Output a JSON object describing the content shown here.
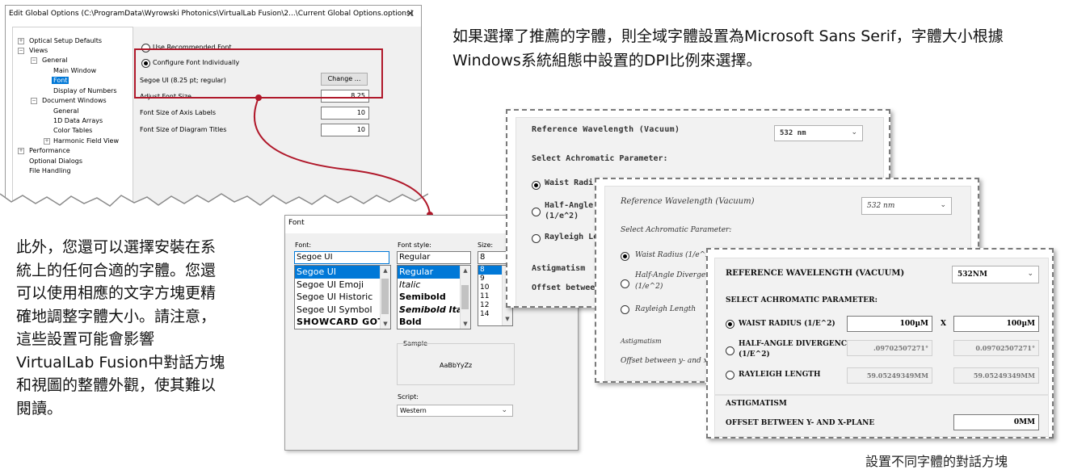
{
  "top_text": "如果選擇了推薦的字體，則全域字體設置為Microsoft Sans Serif，字體大小根據Windows系統組態中設置的DPI比例來選擇。",
  "top_text_lines": [
    "如果選擇了推薦的字體，則全域字體設置為Microsoft Sans Serif，字體大小根據",
    "Windows系統組態中設置的DPI比例來選擇。"
  ],
  "left_text_lines": [
    "此外，您還可以選擇安裝在系",
    "統上的任何合適的字體。您還",
    "可以使用相應的文字方塊更精",
    "確地調整字體大小。請注意，",
    "這些設置可能會影響",
    "VirtualLab Fusion中對話方塊",
    "和視圖的整體外觀，使其難以",
    "閱讀。"
  ],
  "caption": "設置不同字體的對話方塊",
  "global_options": {
    "title": "Edit Global Options (C:\\ProgramData\\Wyrowski Photonics\\VirtualLab Fusion\\2...\\Current Global Options.options)",
    "close": "✕",
    "tree": {
      "optical_setup_defaults": "Optical Setup Defaults",
      "views": "Views",
      "general": "General",
      "main_window": "Main Window",
      "font": "Font",
      "display_of_numbers": "Display of Numbers",
      "document_windows": "Document Windows",
      "dw_general": "General",
      "data_arrays": "1D Data Arrays",
      "color_tables": "Color Tables",
      "harmonic_field_view": "Harmonic Field View",
      "performance": "Performance",
      "optional_dialogs": "Optional Dialogs",
      "file_handling": "File Handling"
    },
    "use_recommended_font": "Use Recommended Font",
    "configure_font_individually": "Configure Font Individually",
    "current_font": "Segoe UI (8.25 pt; regular)",
    "change_button": "Change ...",
    "adjust_font_size_label": "Adjust Font Size",
    "adjust_font_size_value": "8.25",
    "axis_labels_label": "Font Size of Axis Labels",
    "axis_labels_value": "10",
    "diagram_titles_label": "Font Size of Diagram Titles",
    "diagram_titles_value": "10"
  },
  "font_dialog": {
    "title": "Font",
    "font_label": "Font:",
    "font_value": "Segoe UI",
    "fonts": [
      "Segoe UI",
      "Segoe UI Emoji",
      "Segoe UI Historic",
      "Segoe UI Symbol",
      "SHOWCARD GOTHI"
    ],
    "style_label": "Font style:",
    "style_value": "Regular",
    "styles": [
      "Regular",
      "Italic",
      "Semibold",
      "Semibold Italic",
      "Bold"
    ],
    "size_label": "Size:",
    "size_value": "8",
    "sizes": [
      "8",
      "9",
      "10",
      "11",
      "12",
      "14"
    ],
    "sample_label": "Sample",
    "sample_text": "AaBbYyZz",
    "script_label": "Script:",
    "script_value": "Western"
  },
  "dialog_fancy": {
    "ref_wavelength": "Reference Wavelength (Vacuum)",
    "wavelength_value": "532 nm",
    "select_param": "Select Achromatic Parameter:",
    "waist": "Waist Radi",
    "half_angle": "Half-Angle",
    "half_angle_2": "(1/e^2)",
    "rayleigh": "Rayleigh Le",
    "astig": "Astigmatism",
    "offset": "Offset betwee"
  },
  "dialog_script": {
    "ref_wavelength": "Reference Wavelength (Vacuum)",
    "wavelength_value": "532 nm",
    "select_param": "Select Achromatic Parameter:",
    "waist": "Waist Radius (1/e^2)",
    "half_angle": "Half-Angle Divergen",
    "half_angle_2": "(1/e^2)",
    "rayleigh": "Rayleigh Length",
    "astig": "Astigmatism",
    "offset": "Offset between y- and x-P"
  },
  "dialog_caps": {
    "ref_wavelength": "REFERENCE WAVELENGTH (VACUUM)",
    "wavelength_value": "532NM",
    "select_param": "SELECT ACHROMATIC PARAMETER:",
    "waist": "WAIST RADIUS (1/E^2)",
    "waist_x": "100µM",
    "x_sep": "X",
    "waist_y": "100µM",
    "half_angle": "HALF-ANGLE DIVERGENCE",
    "half_angle_2": "(1/E^2)",
    "div_x": ".09702507271°",
    "div_y": "0.09702507271°",
    "rayleigh": "RAYLEIGH LENGTH",
    "ray_x": "59.05249349MM",
    "ray_y": "59.05249349MM",
    "astig": "ASTIGMATISM",
    "offset": "OFFSET BETWEEN Y- AND X-PLANE",
    "offset_value": "0MM"
  },
  "colors": {
    "accent": "#0078d7",
    "highlight_red": "#b0182a"
  }
}
